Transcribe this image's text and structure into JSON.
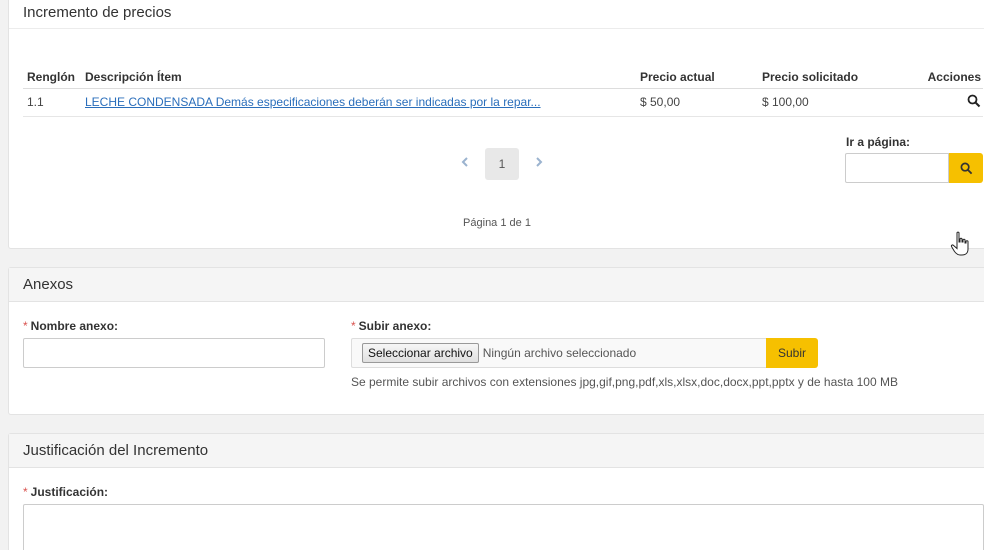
{
  "prices_panel": {
    "title": "Incremento de precios",
    "columns": [
      "Renglón",
      "Descripción Ítem",
      "Precio actual",
      "Precio solicitado",
      "Acciones"
    ],
    "rows": [
      {
        "renglon": "1.1",
        "descripcion": "LECHE CONDENSADA Demás especificaciones deberán ser indicadas por la repar...",
        "precio_actual": "$ 50,00",
        "precio_solicitado": "$ 100,00",
        "accion_icon": "search-icon"
      }
    ],
    "pagination": {
      "prev_icon": "chevron-left-icon",
      "current_page": "1",
      "next_icon": "chevron-right-icon",
      "page_info": "Página 1 de 1"
    },
    "goto": {
      "label": "Ir a página:",
      "value": "",
      "button_icon": "search-icon"
    }
  },
  "anexos_panel": {
    "title": "Anexos",
    "nombre_label": "Nombre anexo:",
    "nombre_value": "",
    "subir_label": "Subir anexo:",
    "file_button": "Seleccionar archivo",
    "file_status": "Ningún archivo seleccionado",
    "upload_button": "Subir",
    "help_text": "Se permite subir archivos con extensiones jpg,gif,png,pdf,xls,xlsx,doc,docx,ppt,pptx y de hasta 100 MB"
  },
  "justificacion_panel": {
    "title": "Justificación del Incremento",
    "label": "Justificación:",
    "value": ""
  },
  "required_marker": "*",
  "colors": {
    "accent_button": "#f6c000",
    "link": "#2a6ebb",
    "required": "#d9534f",
    "pager_arrow": "#9bb3cf"
  }
}
